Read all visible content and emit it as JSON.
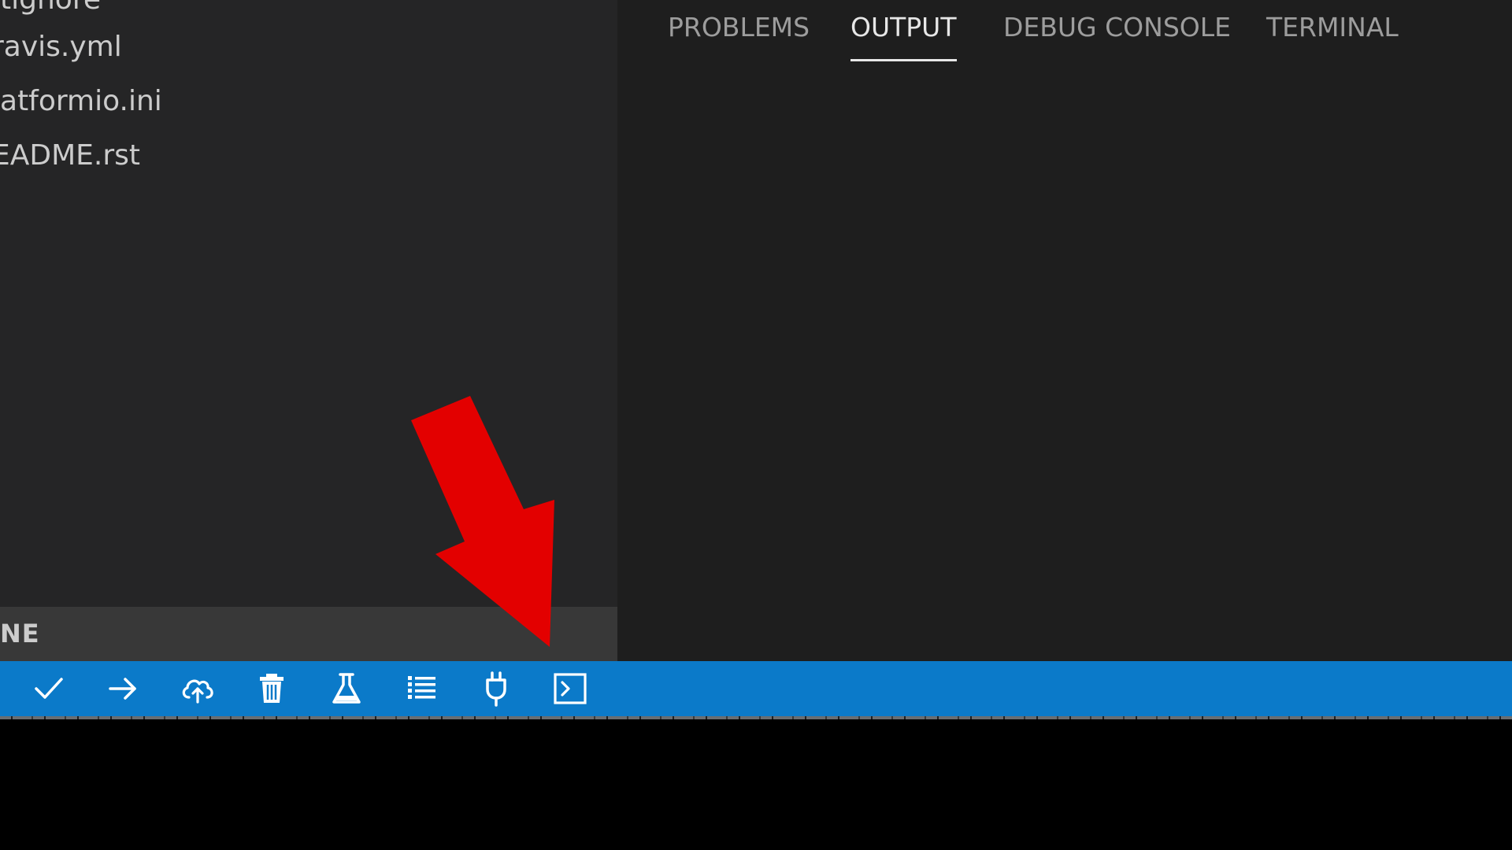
{
  "sidebar": {
    "files": [
      {
        "label": "itignore"
      },
      {
        "label": "ravis.yml"
      },
      {
        "label": "latformio.ini"
      },
      {
        "label": "EADME.rst"
      }
    ],
    "section_header": "NE"
  },
  "panel": {
    "tabs": [
      {
        "label": "PROBLEMS",
        "active": false
      },
      {
        "label": "OUTPUT",
        "active": true
      },
      {
        "label": "DEBUG CONSOLE",
        "active": false
      },
      {
        "label": "TERMINAL",
        "active": false
      }
    ]
  },
  "statusbar": {
    "icons": [
      {
        "name": "build-check-icon",
        "tooltip": ""
      },
      {
        "name": "upload-arrow-icon",
        "tooltip": ""
      },
      {
        "name": "cloud-upload-icon",
        "tooltip": ""
      },
      {
        "name": "trash-clean-icon",
        "tooltip": ""
      },
      {
        "name": "flask-test-icon",
        "tooltip": ""
      },
      {
        "name": "task-list-icon",
        "tooltip": ""
      },
      {
        "name": "serial-plug-icon",
        "tooltip": ""
      },
      {
        "name": "terminal-icon",
        "tooltip": ""
      }
    ]
  },
  "colors": {
    "sidebar_bg": "#252526",
    "panel_bg": "#1e1e1e",
    "section_header_bg": "#383838",
    "statusbar_bg": "#0b7ac9",
    "annotation_arrow": "#e30000",
    "text_primary": "#cccccc",
    "text_active": "#e7e7e7",
    "text_inactive": "#9d9d9d"
  }
}
